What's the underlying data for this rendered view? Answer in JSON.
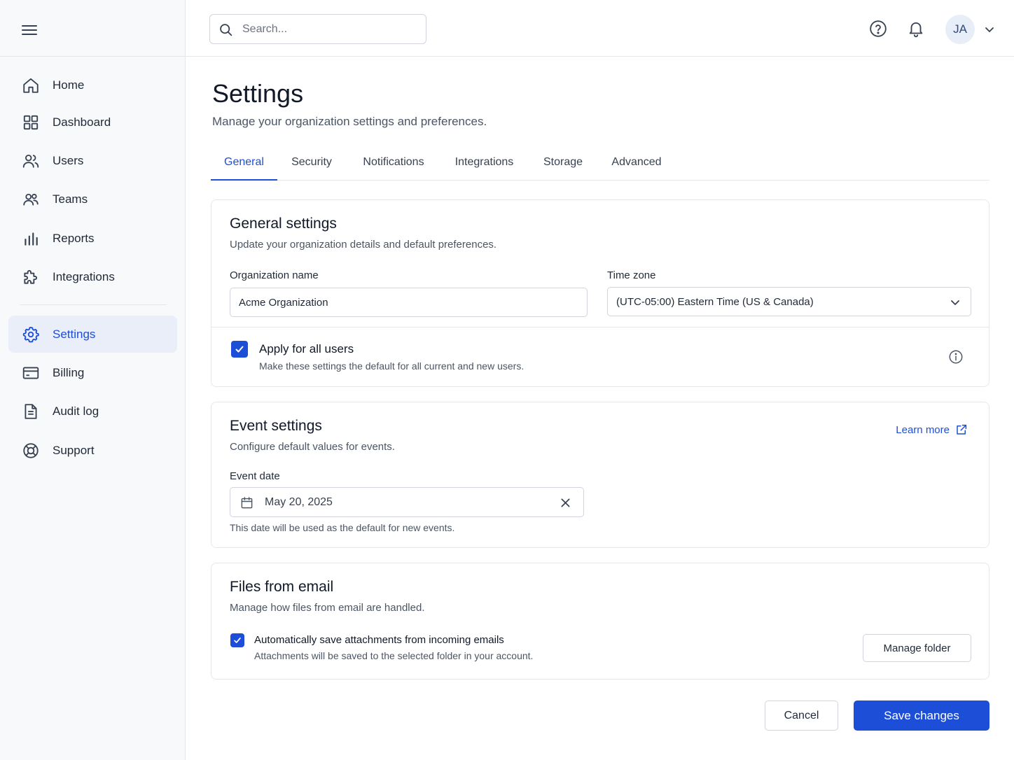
{
  "topbar": {
    "search_placeholder": "Search...",
    "avatar_initials": "JA"
  },
  "sidebar": {
    "items": [
      {
        "label": "Home",
        "icon": "home-icon"
      },
      {
        "label": "Dashboard",
        "icon": "dashboard-icon"
      },
      {
        "label": "Users",
        "icon": "users-icon"
      },
      {
        "label": "Teams",
        "icon": "teams-icon"
      },
      {
        "label": "Reports",
        "icon": "bar-chart-icon"
      },
      {
        "label": "Integrations",
        "icon": "puzzle-icon"
      },
      {
        "label": "Settings",
        "icon": "gear-icon",
        "active": true
      },
      {
        "label": "Billing",
        "icon": "credit-card-icon"
      },
      {
        "label": "Audit log",
        "icon": "document-icon"
      },
      {
        "label": "Support",
        "icon": "lifebuoy-icon"
      }
    ]
  },
  "page": {
    "title": "Settings",
    "subtitle": "Manage your organization settings and preferences."
  },
  "tabs": [
    {
      "label": "General",
      "active": true
    },
    {
      "label": "Security"
    },
    {
      "label": "Notifications"
    },
    {
      "label": "Integrations"
    },
    {
      "label": "Storage"
    },
    {
      "label": "Advanced"
    }
  ],
  "general": {
    "title": "General settings",
    "description": "Update your organization details and default preferences.",
    "org_name_label": "Organization name",
    "org_name_value": "Acme Organization",
    "timezone_label": "Time zone",
    "timezone_value": "(UTC-05:00) Eastern Time (US & Canada)",
    "apply_all_title": "Apply for all users",
    "apply_all_desc": "Make these settings the default for all current and new users.",
    "apply_all_checked": true
  },
  "events": {
    "title": "Event settings",
    "description": "Configure default values for events.",
    "learn_more": "Learn more",
    "date_label": "Event date",
    "date_value": "May 20, 2025",
    "date_hint": "This date will be used as the default for new events."
  },
  "files": {
    "title": "Files from email",
    "description": "Manage how files from email are handled.",
    "auto_save_title": "Automatically save attachments from incoming emails",
    "auto_save_desc": "Attachments will be saved to the selected folder in your account.",
    "auto_save_checked": true,
    "manage_folder": "Manage folder"
  },
  "actions": {
    "cancel": "Cancel",
    "save": "Save changes"
  },
  "colors": {
    "accent": "#1d4ed8",
    "sidebar_bg": "#f8f9fb",
    "active_nav_bg": "#e9eef8"
  }
}
